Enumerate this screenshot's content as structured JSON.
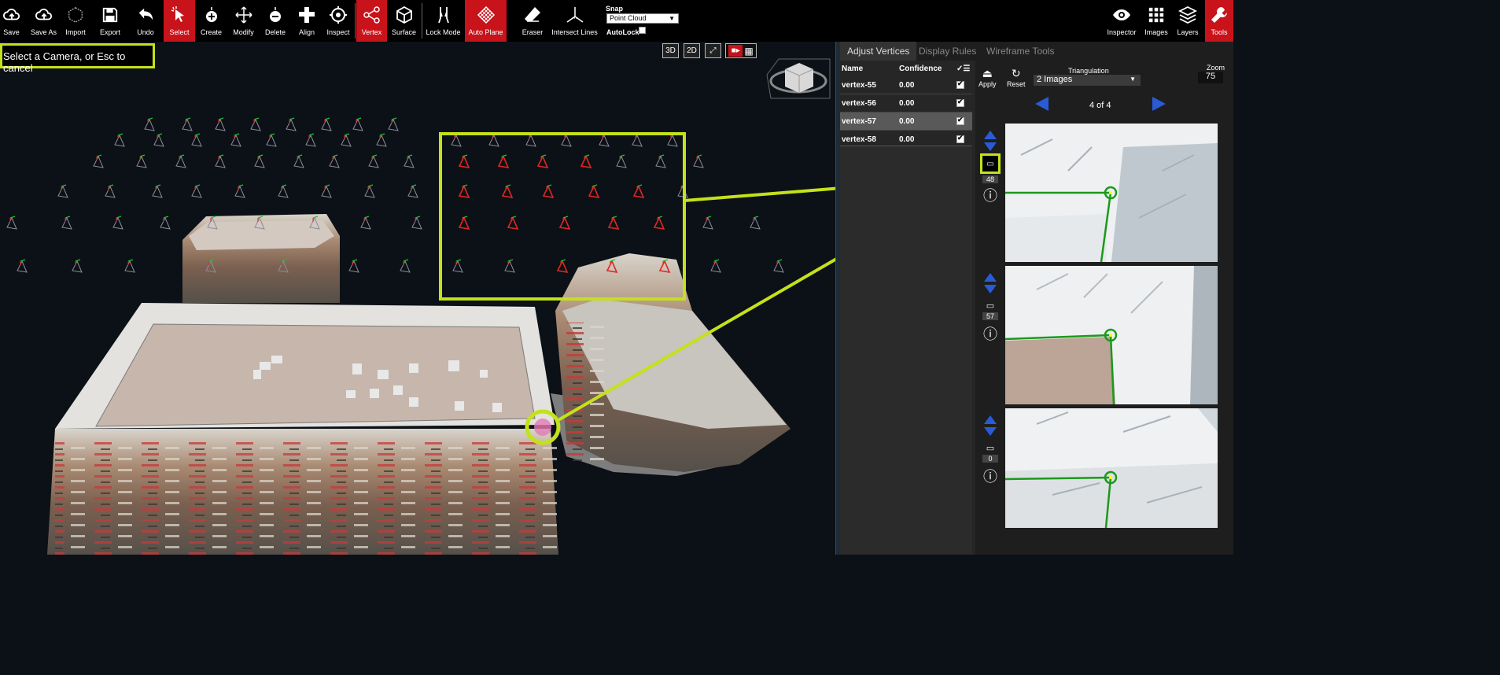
{
  "toolbar": {
    "items": [
      {
        "label": "Save",
        "icon": "cloud-upload-icon"
      },
      {
        "label": "Save As",
        "icon": "cloud-upload-icon"
      },
      {
        "label": "Import",
        "icon": "cube-import-icon"
      },
      {
        "label": "Export",
        "icon": "floppy-disk-icon"
      },
      {
        "label": "Undo",
        "icon": "undo-arrow-icon"
      },
      {
        "label": "Select",
        "icon": "cursor-select-icon"
      },
      {
        "label": "Create",
        "icon": "create-point-icon"
      },
      {
        "label": "Modify",
        "icon": "move-arrows-icon"
      },
      {
        "label": "Delete",
        "icon": "delete-point-icon"
      },
      {
        "label": "Align",
        "icon": "align-icon"
      },
      {
        "label": "Inspect",
        "icon": "inspect-target-icon"
      },
      {
        "label": "Vertex",
        "icon": "vertex-share-icon"
      },
      {
        "label": "Surface",
        "icon": "surface-cube-icon"
      },
      {
        "label": "Lock Mode",
        "icon": "lock-mode-icon"
      },
      {
        "label": "Auto Plane",
        "icon": "auto-plane-grid-icon"
      },
      {
        "label": "Eraser",
        "icon": "eraser-icon"
      },
      {
        "label": "Intersect Lines",
        "icon": "intersect-lines-icon"
      }
    ],
    "active": [
      "Select",
      "Vertex",
      "Auto Plane"
    ],
    "snap": {
      "label": "Snap",
      "value": "Point Cloud"
    },
    "autolock": {
      "label": "AutoLock",
      "checked": false
    },
    "right_items": [
      {
        "label": "Inspector",
        "icon": "eye-icon"
      },
      {
        "label": "Images",
        "icon": "grid-images-icon"
      },
      {
        "label": "Layers",
        "icon": "layers-icon"
      },
      {
        "label": "Tools",
        "icon": "wrench-tools-icon"
      }
    ],
    "right_active": "Tools",
    "accent": "#c8131b"
  },
  "viewport": {
    "status": "Select a Camera, or Esc to cancel",
    "view_buttons": [
      "3D",
      "2D"
    ],
    "highlight_color": "#c4e11b"
  },
  "panel": {
    "tabs": [
      "Adjust Vertices",
      "Display Rules",
      "Wireframe Tools"
    ],
    "active_tab": "Adjust Vertices",
    "table": {
      "headers": {
        "name": "Name",
        "confidence": "Confidence"
      },
      "rows": [
        {
          "name": "vertex-55",
          "confidence": "0.00",
          "checked": true
        },
        {
          "name": "vertex-56",
          "confidence": "0.00",
          "checked": true
        },
        {
          "name": "vertex-57",
          "confidence": "0.00",
          "checked": true,
          "selected": true
        },
        {
          "name": "vertex-58",
          "confidence": "0.00",
          "checked": true
        }
      ]
    },
    "apply_label": "Apply",
    "reset_label": "Reset",
    "triangulation": {
      "label": "Triangulation",
      "value": "2 Images"
    },
    "zoom": {
      "label": "Zoom",
      "value": "75"
    },
    "pager": "4 of 4",
    "images": [
      {
        "count": "48"
      },
      {
        "count": "57"
      },
      {
        "count": "0"
      }
    ]
  }
}
